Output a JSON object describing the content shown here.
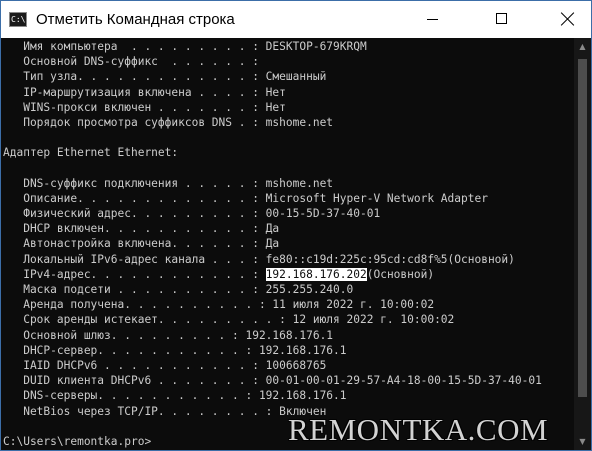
{
  "window": {
    "title": "Отметить Командная строка",
    "app_icon_text": "C:\\.",
    "icon": "cmd-icon",
    "minimize_icon": "minimize-icon",
    "maximize_icon": "maximize-icon",
    "close_icon": "close-icon"
  },
  "console": {
    "lines": [
      {
        "text": "   Имя компьютера  . . . . . . . . . : DESKTOP-679KRQM"
      },
      {
        "text": "   Основной DNS-суффикс  . . . . . . :"
      },
      {
        "text": "   Тип узла. . . . . . . . . . . . . : Смешанный"
      },
      {
        "text": "   IP-маршрутизация включена . . . . : Нет"
      },
      {
        "text": "   WINS-прокси включен . . . . . . . : Нет"
      },
      {
        "text": "   Порядок просмотра суффиксов DNS . : mshome.net"
      },
      {
        "text": ""
      },
      {
        "text": "Адаптер Ethernet Ethernet:"
      },
      {
        "text": ""
      },
      {
        "text": "   DNS-суффикс подключения . . . . . : mshome.net"
      },
      {
        "text": "   Описание. . . . . . . . . . . . . : Microsoft Hyper-V Network Adapter"
      },
      {
        "text": "   Физический адрес. . . . . . . . . : 00-15-5D-37-40-01"
      },
      {
        "text": "   DHCP включен. . . . . . . . . . . : Да"
      },
      {
        "text": "   Автонастройка включена. . . . . . : Да"
      },
      {
        "text": "   Локальный IPv6-адрес канала . . . : fe80::c19d:225c:95cd:cd8f%5(Основной)"
      },
      {
        "text": "   IPv4-адрес. . . . . . . . . . . . : ",
        "selected": "192.168.176.202",
        "after": "(Основной)"
      },
      {
        "text": "   Маска подсети . . . . . . . . . . : 255.255.240.0"
      },
      {
        "text": "   Аренда получена. . . . . . . . . . : 11 июля 2022 г. 10:00:02"
      },
      {
        "text": "   Срок аренды истекает. . . . . . . . . : 12 июля 2022 г. 10:00:02"
      },
      {
        "text": "   Основной шлюз. . . . . . . . . : 192.168.176.1"
      },
      {
        "text": "   DHCP-сервер. . . . . . . . . . . : 192.168.176.1"
      },
      {
        "text": "   IAID DHCPv6 . . . . . . . . . . . : 100668765"
      },
      {
        "text": "   DUID клиента DHCPv6 . . . . . . . : 00-01-00-01-29-57-A4-18-00-15-5D-37-40-01"
      },
      {
        "text": "   DNS-серверы. . . . . . . . . . . : 192.168.176.1"
      },
      {
        "text": "   NetBios через TCP/IP. . . . . . . . : Включен"
      },
      {
        "text": ""
      },
      {
        "text": "C:\\Users\\remontka.pro>"
      }
    ]
  },
  "scrollbar": {
    "up_arrow": "▲",
    "down_arrow": "▼",
    "thumb_fraction_start": 0.1
  },
  "watermark": {
    "text": "REMONTKA.COM"
  }
}
